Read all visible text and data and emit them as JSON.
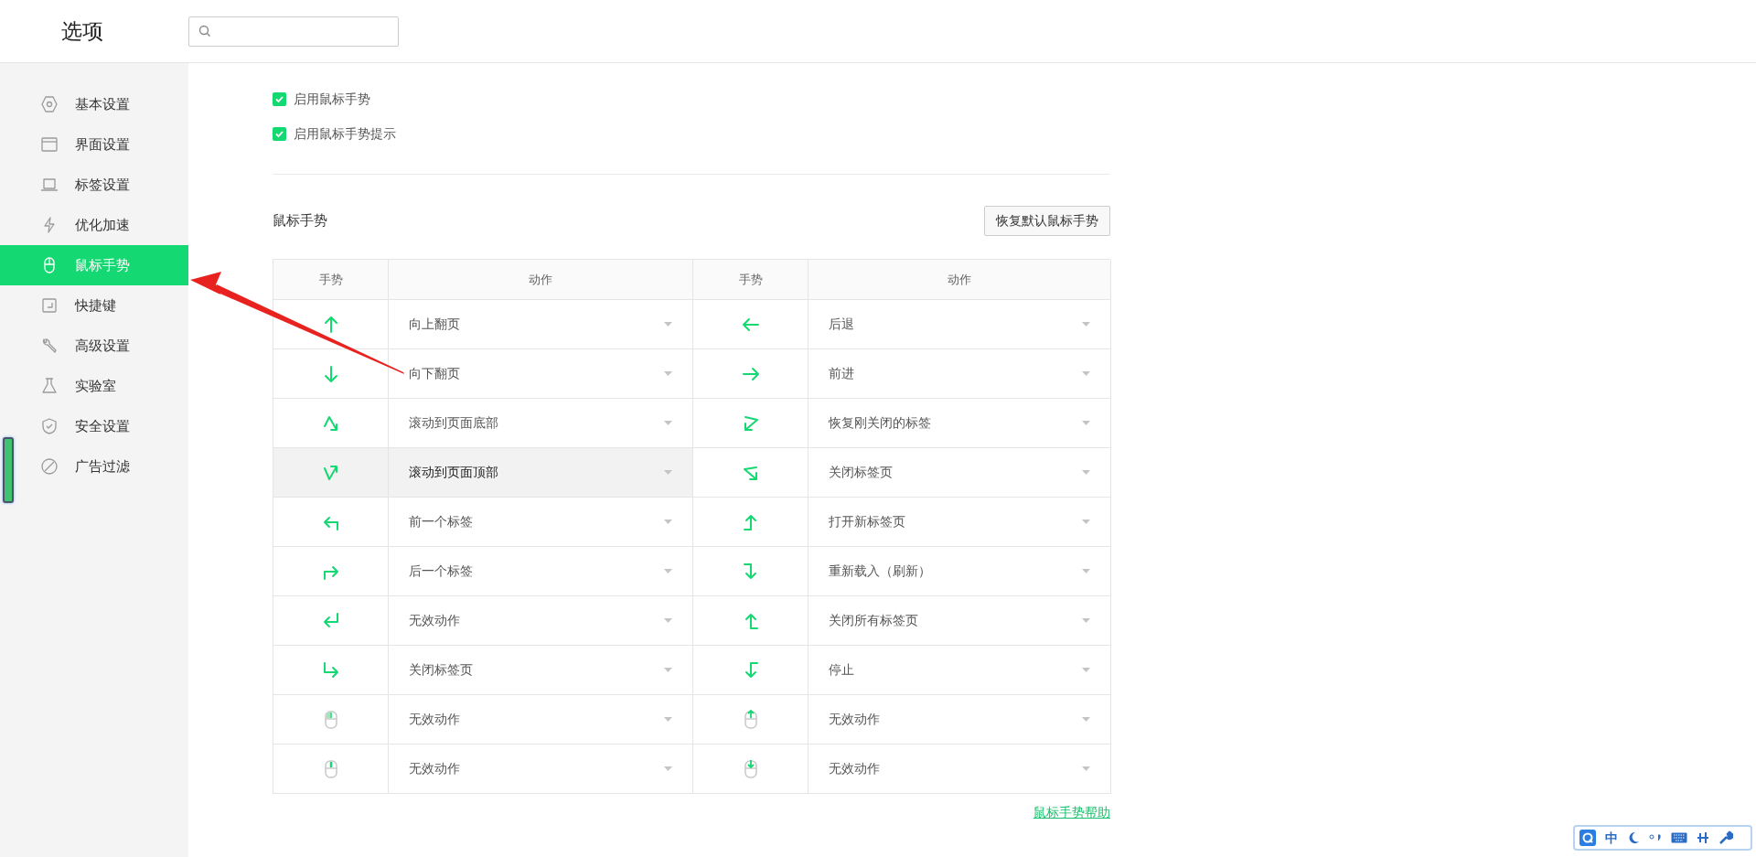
{
  "header": {
    "title": "选项"
  },
  "sidebar": {
    "items": [
      {
        "label": "基本设置",
        "selected": false
      },
      {
        "label": "界面设置",
        "selected": false
      },
      {
        "label": "标签设置",
        "selected": false
      },
      {
        "label": "优化加速",
        "selected": false
      },
      {
        "label": "鼠标手势",
        "selected": true
      },
      {
        "label": "快捷键",
        "selected": false
      },
      {
        "label": "高级设置",
        "selected": false
      },
      {
        "label": "实验室",
        "selected": false
      },
      {
        "label": "安全设置",
        "selected": false
      },
      {
        "label": "广告过滤",
        "selected": false
      }
    ]
  },
  "options": [
    {
      "label": "启用鼠标手势",
      "checked": true
    },
    {
      "label": "启用鼠标手势提示",
      "checked": true
    }
  ],
  "section": {
    "title": "鼠标手势",
    "reset_button": "恢复默认鼠标手势"
  },
  "table": {
    "columns": [
      "手势",
      "动作",
      "手势",
      "动作"
    ],
    "rows": [
      {
        "cells": [
          {
            "action": "向上翻页",
            "hovered": false
          },
          {
            "action": "后退",
            "hovered": false
          }
        ]
      },
      {
        "cells": [
          {
            "action": "向下翻页",
            "hovered": false
          },
          {
            "action": "前进",
            "hovered": false
          }
        ]
      },
      {
        "cells": [
          {
            "action": "滚动到页面底部",
            "hovered": false
          },
          {
            "action": "恢复刚关闭的标签",
            "hovered": false
          }
        ]
      },
      {
        "cells": [
          {
            "action": "滚动到页面顶部",
            "hovered": true
          },
          {
            "action": "关闭标签页",
            "hovered": false
          }
        ]
      },
      {
        "cells": [
          {
            "action": "前一个标签",
            "hovered": false
          },
          {
            "action": "打开新标签页",
            "hovered": false
          }
        ]
      },
      {
        "cells": [
          {
            "action": "后一个标签",
            "hovered": false
          },
          {
            "action": "重新载入（刷新）",
            "hovered": false
          }
        ]
      },
      {
        "cells": [
          {
            "action": "无效动作",
            "hovered": false
          },
          {
            "action": "关闭所有标签页",
            "hovered": false
          }
        ]
      },
      {
        "cells": [
          {
            "action": "关闭标签页",
            "hovered": false
          },
          {
            "action": "停止",
            "hovered": false
          }
        ]
      },
      {
        "cells": [
          {
            "action": "无效动作",
            "hovered": false
          },
          {
            "action": "无效动作",
            "hovered": false
          }
        ]
      },
      {
        "cells": [
          {
            "action": "无效动作",
            "hovered": false
          },
          {
            "action": "无效动作",
            "hovered": false
          }
        ]
      }
    ]
  },
  "help_link": "鼠标手势帮助",
  "ime_toolbar": {
    "mode_label": "中"
  }
}
